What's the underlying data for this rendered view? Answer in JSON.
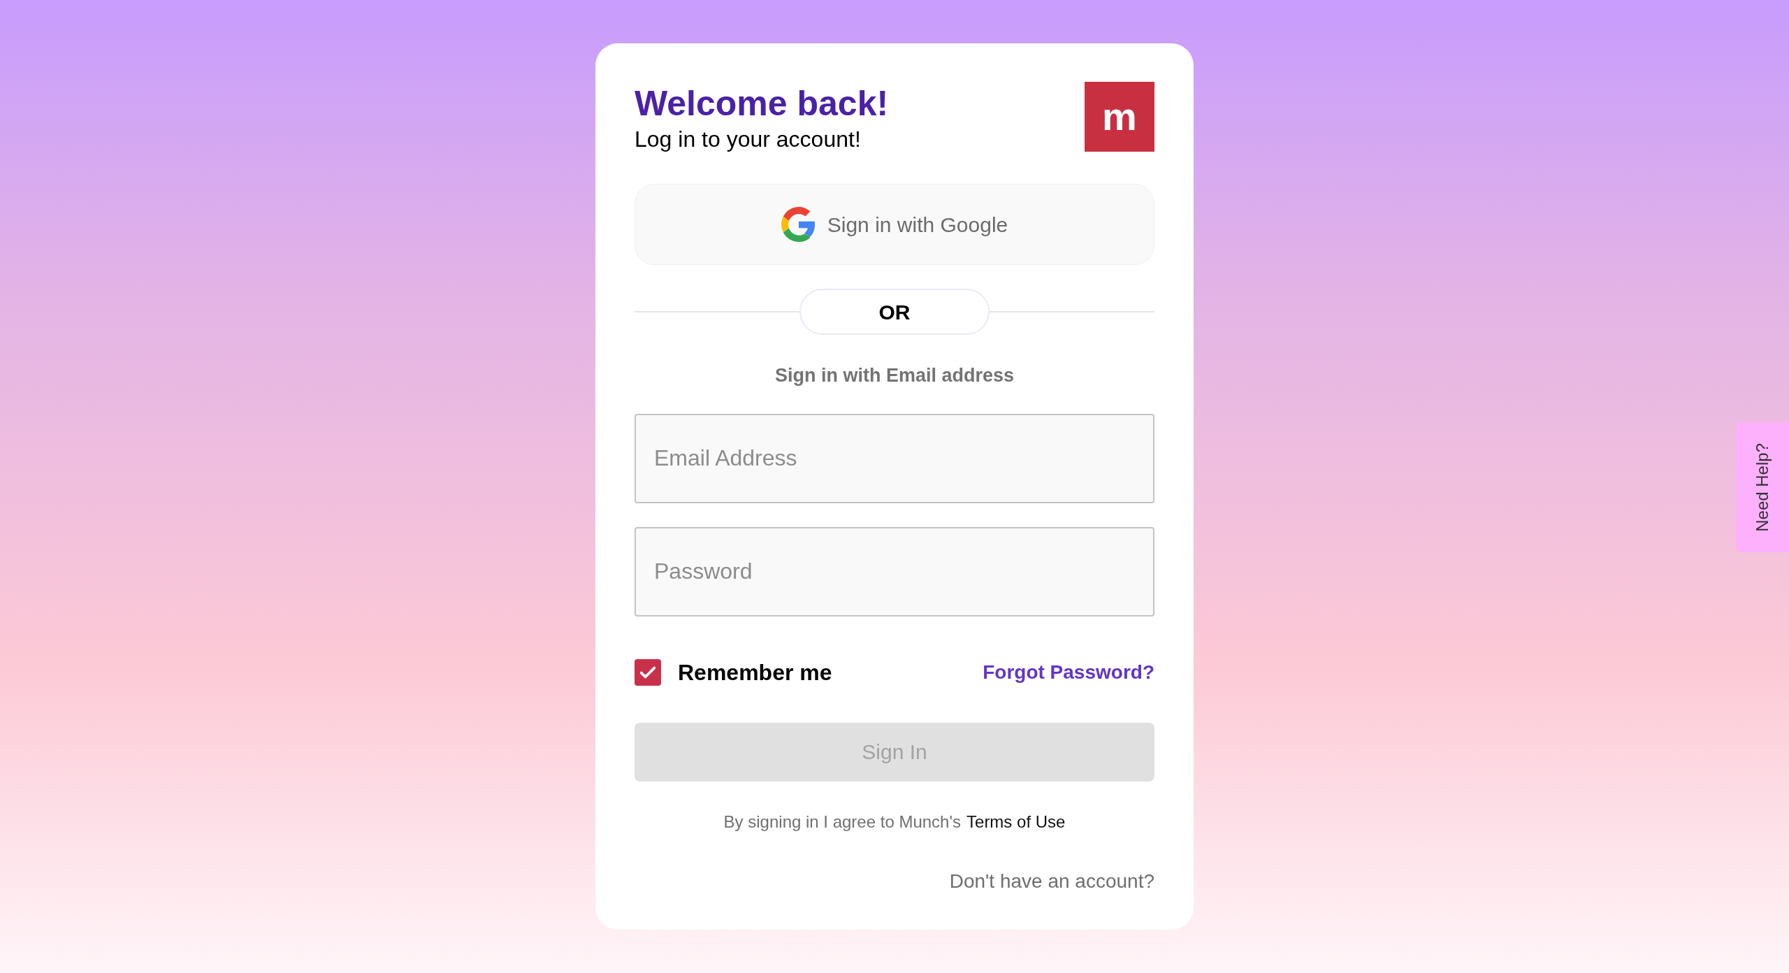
{
  "header": {
    "title": "Welcome back!",
    "subtitle": "Log in to your account!",
    "logo": "m"
  },
  "google_button": {
    "label": "Sign in with Google"
  },
  "divider": {
    "label": "OR"
  },
  "email_heading": "Sign in with Email address",
  "fields": [
    {
      "placeholder": "Email Address"
    },
    {
      "placeholder": "Password"
    }
  ],
  "remember_me": {
    "label": "Remember me",
    "checked": true
  },
  "forgot_link": "Forgot Password?",
  "sign_in_button": {
    "label": "Sign In",
    "disabled": true
  },
  "terms": {
    "text": "By signing in I agree to Munch's",
    "link": "Terms of Use"
  },
  "signup_link": "Don't have an account?",
  "help_tab": "Need Help?"
}
